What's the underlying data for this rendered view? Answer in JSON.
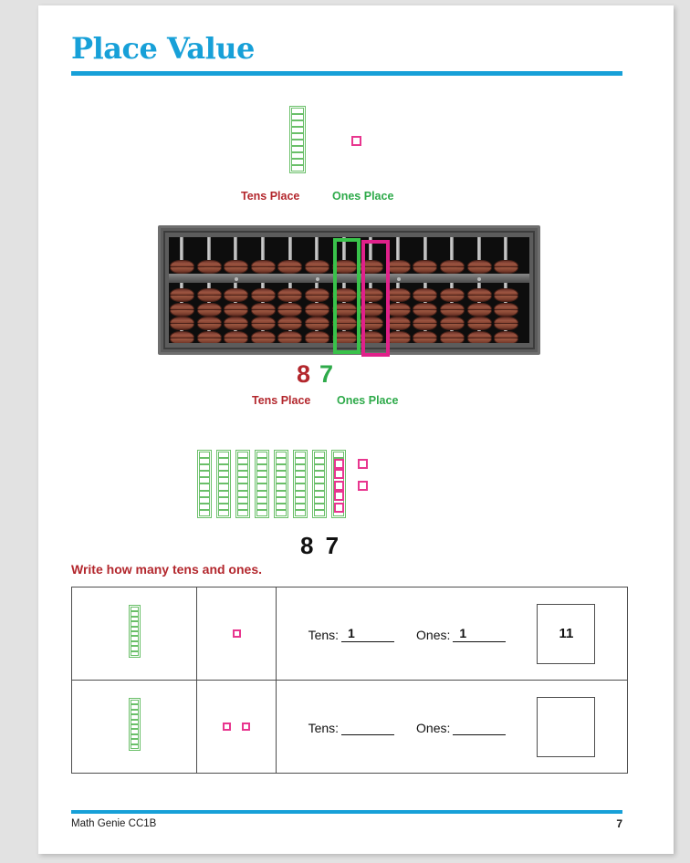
{
  "page": {
    "title": "Place Value",
    "accent_color": "#17a0d8",
    "tens_color": "#b3272d",
    "ones_color": "#2eaa4a",
    "rod_color": "#6abf69",
    "unit_color": "#e8368f"
  },
  "legend": {
    "tens_label": "Tens Place",
    "ones_label": "Ones Place",
    "tens_rod_units": 10,
    "ones_count": 1
  },
  "abacus": {
    "rods": 13,
    "top_beads_per_rod": 1,
    "bottom_beads_per_rod": 4,
    "highlight_tens_rod_index": 6,
    "highlight_ones_rod_index": 7,
    "highlight_tens_color": "#39c24a",
    "highlight_ones_color": "#e0218a",
    "result": {
      "tens_digit": "8",
      "ones_digit": "7",
      "tens_label": "Tens Place",
      "ones_label": "Ones Place"
    }
  },
  "blocks": {
    "tens_rods": 8,
    "rod_units": 10,
    "ones_rows": [
      3,
      3,
      1
    ],
    "ones_total": 7,
    "answer": "8 7"
  },
  "instruction": "Write how many tens and ones.",
  "worksheet": {
    "tens_label": "Tens:",
    "ones_label": "Ones:",
    "rows": [
      {
        "tens_rods": 1,
        "rod_units": 10,
        "ones_count": 1,
        "tens_value": "1",
        "ones_value": "1",
        "answer": "11"
      },
      {
        "tens_rods": 1,
        "rod_units": 10,
        "ones_count": 2,
        "tens_value": "",
        "ones_value": "",
        "answer": ""
      }
    ]
  },
  "footer": {
    "left": "Math Genie CC1B",
    "page_number": "7"
  }
}
